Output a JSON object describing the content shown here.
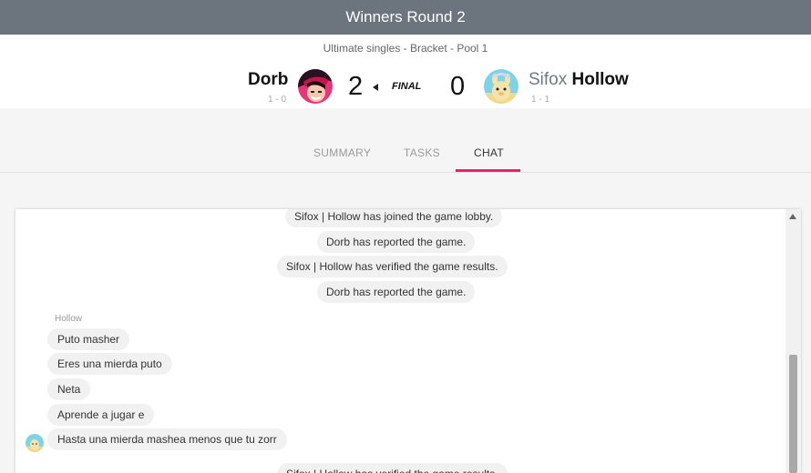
{
  "topbar": {
    "title": "Winners Round 2"
  },
  "header": {
    "subtitle": "Ultimate singles - Bracket - Pool 1",
    "player1": {
      "name": "Dorb",
      "record": "1 - 0",
      "score": "2"
    },
    "status": "FINAL",
    "player2": {
      "prefix": "Sifox",
      "name": "Hollow",
      "record": "1 - 1",
      "score": "0"
    }
  },
  "tabs": [
    {
      "label": "SUMMARY"
    },
    {
      "label": "TASKS"
    },
    {
      "label": "CHAT"
    }
  ],
  "active_tab": "CHAT",
  "chat": {
    "system_messages": [
      "Sifox | Hollow has joined the game lobby.",
      "Dorb has reported the game.",
      "Sifox | Hollow has verified the game results.",
      "Dorb has reported the game.",
      "Sifox | Hollow has verified the game results."
    ],
    "sender": "Hollow",
    "messages": [
      "Puto masher",
      "Eres una mierda puto",
      "Neta",
      "Aprende a jugar e",
      "Hasta una mierda mashea menos que tu zorr"
    ]
  },
  "colors": {
    "topbar": "#6c747d",
    "accent": "#e3246a",
    "bubble": "#f1f1f1"
  }
}
